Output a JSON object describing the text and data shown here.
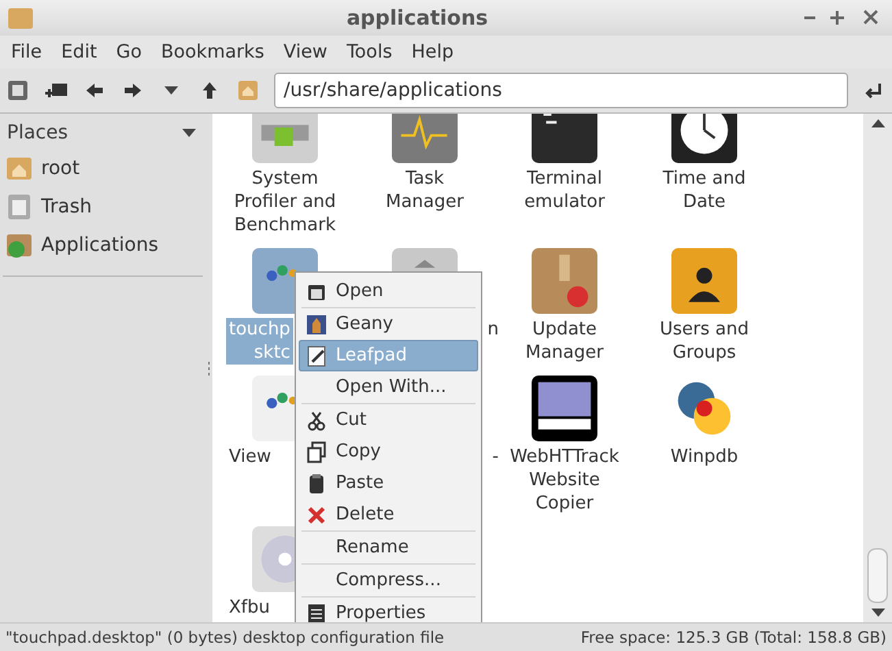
{
  "window": {
    "title": "applications"
  },
  "menu": [
    "File",
    "Edit",
    "Go",
    "Bookmarks",
    "View",
    "Tools",
    "Help"
  ],
  "location": {
    "value": "/usr/share/applications"
  },
  "places": {
    "title": "Places",
    "items": [
      {
        "label": "root",
        "selected": false
      },
      {
        "label": "Trash",
        "selected": false
      },
      {
        "label": "Applications",
        "selected": false
      }
    ]
  },
  "items": [
    {
      "label": "System\nProfiler and\nBenchmark",
      "kind": "full",
      "selected": false
    },
    {
      "label": "Task\nManager",
      "kind": "full",
      "selected": false
    },
    {
      "label": "Terminal\nemulator",
      "kind": "full",
      "selected": false
    },
    {
      "label": "Time and\nDate",
      "kind": "full",
      "selected": false
    },
    {
      "label": "touchp\nsktc",
      "kind": "cut_right",
      "selected": true
    },
    {
      "label": "n",
      "kind": "cut_left",
      "selected": false
    },
    {
      "label": "Update\nManager",
      "kind": "full",
      "selected": false
    },
    {
      "label": "Users and\nGroups",
      "kind": "full",
      "selected": false
    },
    {
      "label": "View",
      "kind": "cut_right",
      "selected": false
    },
    {
      "label": "-",
      "kind": "cut_left",
      "selected": false
    },
    {
      "label": "WebHTTrack\nWebsite\nCopier",
      "kind": "full",
      "selected": false
    },
    {
      "label": "Winpdb",
      "kind": "full",
      "selected": false
    },
    {
      "label": "Xfbu",
      "kind": "cut_right",
      "selected": false
    }
  ],
  "context_menu": [
    {
      "kind": "item",
      "label": "Open",
      "selected": false
    },
    {
      "kind": "separator"
    },
    {
      "kind": "item",
      "label": "Geany",
      "selected": false
    },
    {
      "kind": "item",
      "label": "Leafpad",
      "selected": true
    },
    {
      "kind": "item",
      "label": "Open With...",
      "selected": false
    },
    {
      "kind": "separator"
    },
    {
      "kind": "item",
      "label": "Cut",
      "selected": false
    },
    {
      "kind": "item",
      "label": "Copy",
      "selected": false
    },
    {
      "kind": "item",
      "label": "Paste",
      "selected": false
    },
    {
      "kind": "item",
      "label": "Delete",
      "selected": false
    },
    {
      "kind": "separator"
    },
    {
      "kind": "item",
      "label": "Rename",
      "selected": false
    },
    {
      "kind": "separator"
    },
    {
      "kind": "item",
      "label": "Compress...",
      "selected": false
    },
    {
      "kind": "separator"
    },
    {
      "kind": "item",
      "label": "Properties",
      "selected": false
    }
  ],
  "status_bar": {
    "left": "\"touchpad.desktop\" (0 bytes) desktop configuration file",
    "right": "Free space: 125.3 GB (Total: 158.8 GB)"
  }
}
